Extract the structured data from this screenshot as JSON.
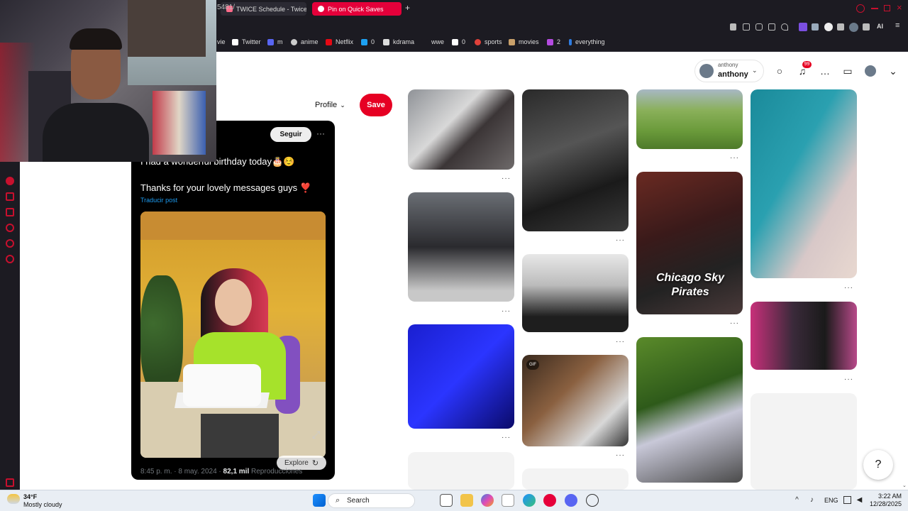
{
  "browser": {
    "tabs": [
      {
        "label": "TWICE Schedule - Twicel",
        "active": false
      },
      {
        "label": "Pin on Quick Saves",
        "active": true
      }
    ],
    "new_tab": "+",
    "address": "5481/",
    "bookmarks": [
      {
        "label": "vie"
      },
      {
        "label": "Twitter"
      },
      {
        "label": "m"
      },
      {
        "label": "anime"
      },
      {
        "label": "Netflix"
      },
      {
        "label": "0"
      },
      {
        "label": "kdrama"
      },
      {
        "label": "wwe"
      },
      {
        "label": "0"
      },
      {
        "label": "sports"
      },
      {
        "label": "movies"
      },
      {
        "label": "2"
      },
      {
        "label": "everything"
      }
    ],
    "ext_label": "AI"
  },
  "header": {
    "user_small": "anthony",
    "user_name": "anthony",
    "notification_count": "99"
  },
  "pin_actions": {
    "profile_label": "Profile",
    "save_label": "Save"
  },
  "tweet": {
    "follow_label": "Seguir",
    "more": "···",
    "line1": "I had a wonderful birthday today🎂☺️",
    "line2": "Thanks for your lovely messages guys ❣️",
    "translate": "Traducir post",
    "explore_label": "Explore",
    "meta_time": "8:45 p. m. · 8 may. 2024 · ",
    "meta_views": "82,1 mil",
    "meta_views_label": " Reproducciones"
  },
  "grid": {
    "more": "···",
    "chicago_text": "Chicago Sky Pirates",
    "gif_badge": "GIF"
  },
  "help": "?",
  "taskbar": {
    "weather_temp": "34°F",
    "weather_desc": "Mostly cloudy",
    "search": "Search",
    "lang": "ENG",
    "time": "3:22 AM",
    "date": "12/28/2025"
  },
  "colors": {
    "pinterest_red": "#e60023",
    "chrome_bg": "#1c1b22",
    "tab_active": "#e4003a"
  }
}
